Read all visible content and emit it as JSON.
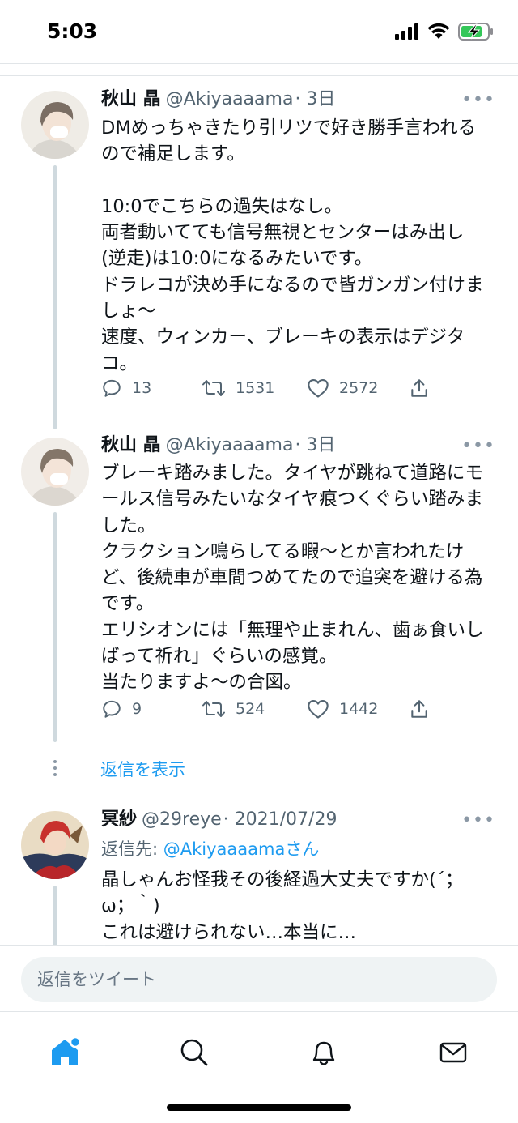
{
  "status_bar": {
    "time": "5:03"
  },
  "tweets": [
    {
      "name": "秋山 晶",
      "handle": "@Akiyaaaama",
      "time": "· 3日",
      "text": "DMめっちゃきたり引リツで好き勝手言われる\nので補足します。\n\n10:0でこちらの過失はなし。\n両者動いてても信号無視とセンターはみ出し\n(逆走)は10:0になるみたいです。\nドラレコが決め手になるので皆ガンガン付けま\nしょ〜\n速度、ウィンカー、ブレーキの表示はデジタ\nコ。",
      "replies": "13",
      "retweets": "1531",
      "likes": "2572"
    },
    {
      "name": "秋山 晶",
      "handle": "@Akiyaaaama",
      "time": "· 3日",
      "text": "ブレーキ踏みました。タイヤが跳ねて道路にモ\nールス信号みたいなタイヤ痕つくぐらい踏みま\nした。\nクラクション鳴らしてる暇〜とか言われたけ\nど、後続車が車間つめてたので追突を避ける為\nです。\nエリシオンには「無理や止まれん、歯ぁ食いし\nばって祈れ」ぐらいの感覚。\n当たりますよ〜の合図。",
      "replies": "9",
      "retweets": "524",
      "likes": "1442"
    }
  ],
  "show_replies": "返信を表示",
  "reply_tweet": {
    "name": "冥紗",
    "handle": "@29reye",
    "time": "· 2021/07/29",
    "reply_to_label": "返信先:",
    "reply_to_mention": "@Akiyaaaamaさん",
    "text": "晶しゃんお怪我その後経過大丈夫ですか(´；\nω；｀)\nこれは避けられない…本当に…"
  },
  "reply_input": {
    "placeholder": "返信をツイート"
  },
  "tabs": [
    "home-icon",
    "search-icon",
    "notifications-icon",
    "messages-icon"
  ],
  "colors": {
    "accent": "#1d9bf0",
    "secondary_text": "#536471",
    "battery": "#34c759"
  }
}
